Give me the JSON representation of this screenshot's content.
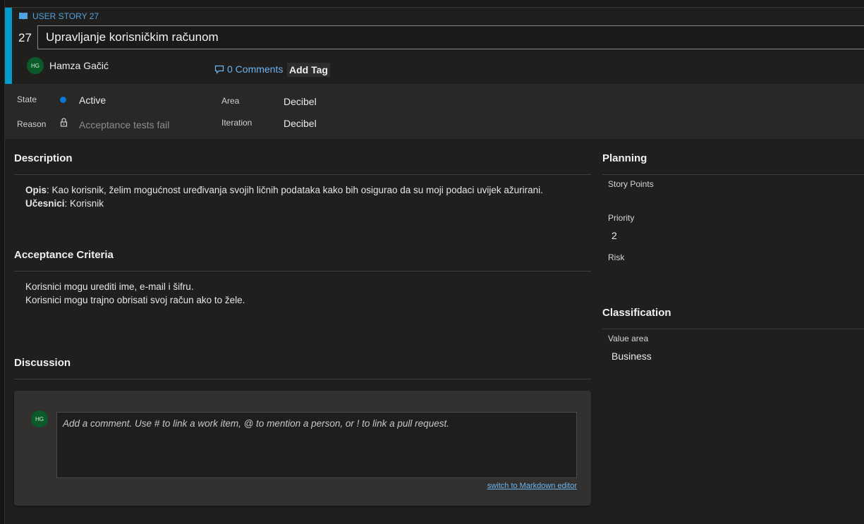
{
  "header": {
    "work_item_type": "USER STORY 27",
    "id": "27",
    "title": "Upravljanje korisničkim računom",
    "assignee": {
      "initials": "HG",
      "name": "Hamza Gačić"
    },
    "comments_label": "0 Comments",
    "add_tag_label": "Add Tag"
  },
  "fields": {
    "state": {
      "label": "State",
      "value": "Active"
    },
    "reason": {
      "label": "Reason",
      "value": "Acceptance tests fail"
    },
    "area": {
      "label": "Area",
      "value": "Decibel"
    },
    "iteration": {
      "label": "Iteration",
      "value": "Decibel"
    }
  },
  "description": {
    "title": "Description",
    "opis_label": "Opis",
    "opis_text": ": Kao korisnik, želim mogućnost uređivanja svojih ličnih podataka kako bih osigurao da su moji podaci uvijek ažurirani.",
    "ucesnici_label": "Učesnici",
    "ucesnici_text": ": Korisnik"
  },
  "acceptance": {
    "title": "Acceptance Criteria",
    "line1": "Korisnici mogu urediti ime, e-mail i šifru.",
    "line2": "Korisnici mogu trajno obrisati svoj račun ako to žele."
  },
  "discussion": {
    "title": "Discussion",
    "avatar_initials": "HG",
    "placeholder": "Add a comment. Use # to link a work item, @ to mention a person, or ! to link a pull request.",
    "markdown_link": "switch to Markdown editor"
  },
  "planning": {
    "title": "Planning",
    "story_points_label": "Story Points",
    "story_points_value": "",
    "priority_label": "Priority",
    "priority_value": "2",
    "risk_label": "Risk",
    "risk_value": ""
  },
  "classification": {
    "title": "Classification",
    "value_area_label": "Value area",
    "value_area_value": "Business"
  },
  "colors": {
    "accent": "#009ccc",
    "state_active": "#0a78d4",
    "link": "#6cb4f0"
  }
}
